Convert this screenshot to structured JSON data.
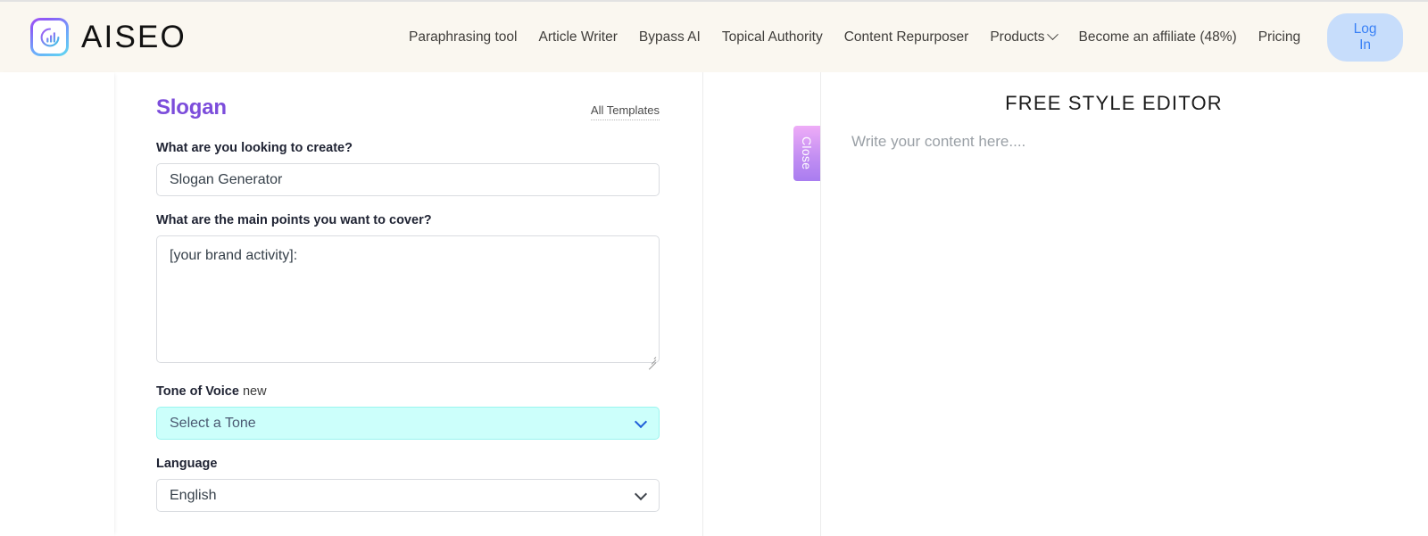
{
  "header": {
    "brand_name": "AISEO",
    "logo_icon": "aiseo-chart-logo-icon",
    "nav": [
      {
        "label": "Paraphrasing tool",
        "has_caret": false
      },
      {
        "label": "Article Writer",
        "has_caret": false
      },
      {
        "label": "Bypass AI",
        "has_caret": false
      },
      {
        "label": "Topical Authority",
        "has_caret": false
      },
      {
        "label": "Content Repurposer",
        "has_caret": false
      },
      {
        "label": "Products",
        "has_caret": true
      },
      {
        "label": "Become an affiliate (48%)",
        "has_caret": false
      },
      {
        "label": "Pricing",
        "has_caret": false
      }
    ],
    "login_label": "Log In",
    "background_color": "#faf7f0",
    "login_bg_color": "#c7ddfb",
    "login_text_color": "#3b82f6"
  },
  "form": {
    "title": "Slogan",
    "title_color": "#7c4ddb",
    "all_templates_label": "All Templates",
    "fields": {
      "create": {
        "label": "What are you looking to create?",
        "value": "Slogan Generator",
        "placeholder": ""
      },
      "main_points": {
        "label": "What are the main points you want to cover?",
        "value": "[your brand activity]:",
        "placeholder": ""
      },
      "tone": {
        "label": "Tone of Voice",
        "label_badge": "new",
        "value": "Select a Tone",
        "highlight_bg": "#ccfffb",
        "highlight_border": "#9bf4ef"
      },
      "language": {
        "label": "Language",
        "value": "English"
      }
    }
  },
  "divider": {
    "close_label": "Close",
    "gradient_from": "#eeacf7",
    "gradient_to": "#a97df0"
  },
  "editor": {
    "title": "FREE STYLE EDITOR",
    "placeholder": "Write your content here...."
  }
}
